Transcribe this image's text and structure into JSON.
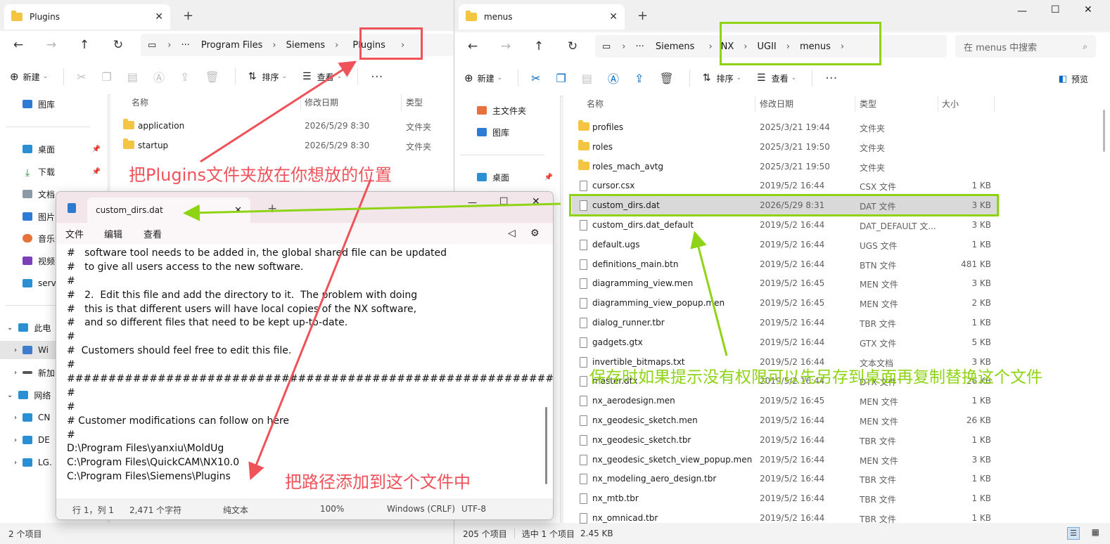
{
  "colors": {
    "red_annotation": "#f0525a",
    "green_annotation": "#8fd414",
    "folder": "#f4c542",
    "accent": "#0067c0"
  },
  "left_explorer": {
    "tab_title": "Plugins",
    "address": [
      "Program Files",
      "Siemens",
      "Plugins"
    ],
    "toolbar": {
      "new_label": "新建",
      "sort_label": "排序",
      "view_label": "查看"
    },
    "nav": [
      "图库",
      "桌面",
      "下载",
      "文档",
      "图片",
      "音乐",
      "视频",
      "serv",
      "此电",
      "Wi",
      "新加",
      "网络",
      "CN",
      "DE",
      "LG."
    ],
    "columns": [
      "名称",
      "修改日期",
      "类型"
    ],
    "rows": [
      {
        "name": "application",
        "date": "2026/5/29 8:30",
        "type": "文件夹"
      },
      {
        "name": "startup",
        "date": "2026/5/29 8:30",
        "type": "文件夹"
      }
    ],
    "status": "2 个项目"
  },
  "right_explorer": {
    "tab_title": "menus",
    "address": [
      "Siemens",
      "NX",
      "UGII",
      "menus"
    ],
    "search_placeholder": "在 menus 中搜索",
    "toolbar": {
      "new_label": "新建",
      "sort_label": "排序",
      "view_label": "查看",
      "preview_label": "预览"
    },
    "nav": [
      "主文件夹",
      "图库",
      "桌面"
    ],
    "columns": [
      "名称",
      "修改日期",
      "类型",
      "大小"
    ],
    "rows": [
      {
        "name": "profiles",
        "date": "2025/3/21 19:44",
        "type": "文件夹",
        "size": "",
        "kind": "folder"
      },
      {
        "name": "roles",
        "date": "2025/3/21 19:50",
        "type": "文件夹",
        "size": "",
        "kind": "folder"
      },
      {
        "name": "roles_mach_avtg",
        "date": "2025/3/21 19:50",
        "type": "文件夹",
        "size": "",
        "kind": "folder"
      },
      {
        "name": "cursor.csx",
        "date": "2019/5/2 16:44",
        "type": "CSX 文件",
        "size": "1 KB",
        "kind": "file"
      },
      {
        "name": "custom_dirs.dat",
        "date": "2026/5/29 8:31",
        "type": "DAT 文件",
        "size": "3 KB",
        "kind": "file"
      },
      {
        "name": "custom_dirs.dat_default",
        "date": "2019/5/2 16:44",
        "type": "DAT_DEFAULT 文...",
        "size": "3 KB",
        "kind": "file"
      },
      {
        "name": "default.ugs",
        "date": "2019/5/2 16:44",
        "type": "UGS 文件",
        "size": "1 KB",
        "kind": "file"
      },
      {
        "name": "definitions_main.btn",
        "date": "2019/5/2 16:44",
        "type": "BTN 文件",
        "size": "481 KB",
        "kind": "file"
      },
      {
        "name": "diagramming_view.men",
        "date": "2019/5/2 16:45",
        "type": "MEN 文件",
        "size": "3 KB",
        "kind": "file"
      },
      {
        "name": "diagramming_view_popup.men",
        "date": "2019/5/2 16:45",
        "type": "MEN 文件",
        "size": "2 KB",
        "kind": "file"
      },
      {
        "name": "dialog_runner.tbr",
        "date": "2019/5/2 16:44",
        "type": "TBR 文件",
        "size": "1 KB",
        "kind": "file"
      },
      {
        "name": "gadgets.gtx",
        "date": "2019/5/2 16:44",
        "type": "GTX 文件",
        "size": "5 KB",
        "kind": "file"
      },
      {
        "name": "invertible_bitmaps.txt",
        "date": "2019/5/2 16:44",
        "type": "文本文档",
        "size": "3 KB",
        "kind": "file"
      },
      {
        "name": "master.dtx",
        "date": "2019/5/2 16:44",
        "type": "DTX 文件",
        "size": "26 KB",
        "kind": "file"
      },
      {
        "name": "nx_aerodesign.men",
        "date": "2019/5/2 16:45",
        "type": "MEN 文件",
        "size": "1 KB",
        "kind": "file"
      },
      {
        "name": "nx_geodesic_sketch.men",
        "date": "2019/5/2 16:44",
        "type": "MEN 文件",
        "size": "26 KB",
        "kind": "file"
      },
      {
        "name": "nx_geodesic_sketch.tbr",
        "date": "2019/5/2 16:44",
        "type": "TBR 文件",
        "size": "1 KB",
        "kind": "file"
      },
      {
        "name": "nx_geodesic_sketch_view_popup.men",
        "date": "2019/5/2 16:44",
        "type": "MEN 文件",
        "size": "3 KB",
        "kind": "file"
      },
      {
        "name": "nx_modeling_aero_design.tbr",
        "date": "2019/5/2 16:44",
        "type": "TBR 文件",
        "size": "1 KB",
        "kind": "file"
      },
      {
        "name": "nx_mtb.tbr",
        "date": "2019/5/2 16:44",
        "type": "TBR 文件",
        "size": "1 KB",
        "kind": "file"
      },
      {
        "name": "nx_omnicad.tbr",
        "date": "2019/5/2 16:44",
        "type": "TBR 文件",
        "size": "1 KB",
        "kind": "file"
      }
    ],
    "selected_index": 4,
    "status": {
      "count": "205 个项目",
      "selected": "选中 1 个项目",
      "size": "2.45 KB"
    }
  },
  "notepad": {
    "tab_title": "custom_dirs.dat",
    "menu": [
      "文件",
      "编辑",
      "查看"
    ],
    "lines": [
      "#   software tool needs to be added in, the global shared file can be updated",
      "#   to give all users access to the new software.",
      "#",
      "#   2.  Edit this file and add the directory to it.  The problem with doing",
      "#   this is that different users will have local copies of the NX software,",
      "#   and so different files that need to be kept up-to-date.",
      "#",
      "#  Customers should feel free to edit this file.",
      "#",
      "####################################################################",
      "#",
      "#",
      "# Customer modifications can follow on here",
      "#",
      "D:\\Program Files\\yanxiu\\MoldUg",
      "C:\\Program Files\\QuickCAM\\NX10.0",
      "C:\\Program Files\\Siemens\\Plugins"
    ],
    "status": {
      "position": "行 1，列 1",
      "chars": "2,471 个字符",
      "format": "纯文本",
      "zoom": "100%",
      "eol": "Windows (CRLF)",
      "encoding": "UTF-8"
    }
  },
  "annotations": {
    "move_plugins": "把Plugins文件夹放在你想放的位置",
    "add_path": "把路径添加到这个文件中",
    "save_hint": "保存时如果提示没有权限可以先另存到桌面再复制替换这个文件"
  }
}
